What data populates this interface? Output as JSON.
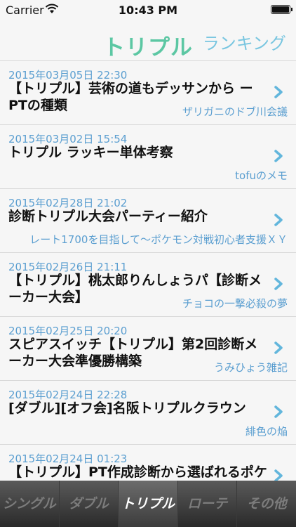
{
  "status_bar": {
    "carrier": "Carrier",
    "time": "10:43 PM"
  },
  "nav": {
    "title": "トリプル",
    "ranking_label": "ランキング"
  },
  "entries": [
    {
      "date": "2015年03月05日 22:30",
      "title": "【トリプル】芸術の道もデッサンから ー PTの種類",
      "source": "ザリガニのドブ川会議"
    },
    {
      "date": "2015年03月02日 15:54",
      "title": "トリプル ラッキー単体考察",
      "source": "tofuのメモ"
    },
    {
      "date": "2015年02月28日 21:02",
      "title": "診断トリプル大会パーティー紹介",
      "source": "レート1700を目指して〜ポケモン対戦初心者支援ＸＹ"
    },
    {
      "date": "2015年02月26日 21:11",
      "title": "【トリプル】桃太郎りんしょうパ【診断メーカー大会】",
      "source": "チョコの一撃必殺の夢"
    },
    {
      "date": "2015年02月25日 20:20",
      "title": "スピアスイッチ【トリプル】第2回診断メーカー大会準優勝構築",
      "source": "うみひょう雑記"
    },
    {
      "date": "2015年02月24日 22:28",
      "title": "[ダブル][オフ会]名阪トリプルクラウン",
      "source": "緋色の焔"
    },
    {
      "date": "2015年02月24日 01:23",
      "title": "【トリプル】PT作成診断から選ばれるポケモ",
      "source": ""
    }
  ],
  "tabs": [
    "シングル",
    "ダブル",
    "トリプル",
    "ローテ",
    "その他"
  ],
  "active_tab": "トリプル",
  "colors": {
    "accent": "#5cc7a3",
    "link": "#5a9ed0",
    "ranking": "#79c6e0"
  }
}
